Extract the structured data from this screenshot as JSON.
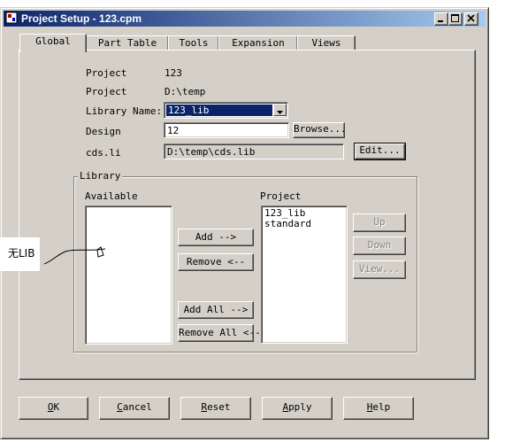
{
  "window": {
    "title": "Project Setup - 123.cpm"
  },
  "tabs": [
    {
      "label": "Global"
    },
    {
      "label": "Part Table"
    },
    {
      "label": "Tools"
    },
    {
      "label": "Expansion"
    },
    {
      "label": "Views"
    }
  ],
  "info": {
    "project_label": "Project",
    "project_value": "123",
    "path_label": "Project",
    "path_value": "D:\\temp",
    "library_name_label": "Library Name:",
    "library_name_value": "123_lib",
    "design_label": "Design",
    "design_value": "12",
    "browse_label": "Browse...",
    "cds_label": "cds.li",
    "cds_value": "D:\\temp\\cds.lib",
    "edit_label": "Edit..."
  },
  "library": {
    "group_title": "Library",
    "available_label": "Available",
    "project_label": "Project",
    "available_items": [],
    "project_items": [
      "123_lib",
      "standard"
    ],
    "add_label": "Add -->",
    "remove_label": "Remove <--",
    "add_all_label": "Add All -->",
    "remove_all_label": "Remove All <--",
    "up_label": "Up",
    "down_label": "Down",
    "view_label": "View..."
  },
  "footer": {
    "ok": {
      "mnemonic": "O",
      "rest": "K"
    },
    "cancel": {
      "mnemonic": "C",
      "rest": "ancel"
    },
    "reset": {
      "mnemonic": "R",
      "rest": "eset"
    },
    "apply": {
      "mnemonic": "A",
      "rest": "pply"
    },
    "help": {
      "mnemonic": "H",
      "rest": "elp"
    }
  },
  "annotation": {
    "text": "无LIB"
  },
  "colors": {
    "titlebar_start": "#0a246a",
    "titlebar_end": "#a6caf0",
    "face": "#d4d0c8",
    "selection": "#0a246a"
  },
  "icons": {
    "app": "project-setup-icon",
    "minimize": "minimize-icon",
    "maximize": "maximize-icon",
    "close": "close-icon",
    "dropdown": "chevron-down-icon"
  }
}
